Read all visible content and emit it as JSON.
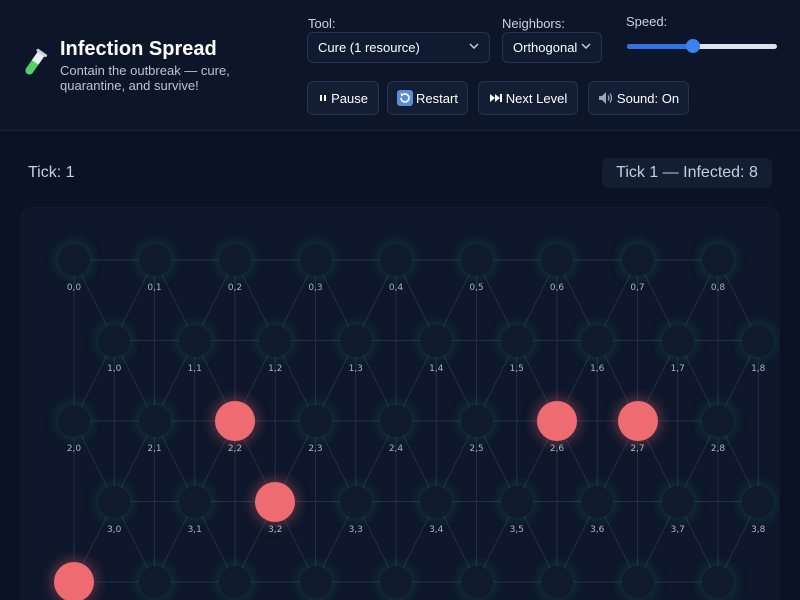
{
  "app": {
    "title": "Infection Spread",
    "subtitle": "Contain the outbreak — cure, quarantine, and survive!",
    "icon": "test-tube-icon"
  },
  "controls": {
    "tool": {
      "label": "Tool:",
      "value": "Cure (1 resource)"
    },
    "neighbors": {
      "label": "Neighbors:",
      "value": "Orthogonal"
    },
    "speed": {
      "label": "Speed:",
      "value": 0.44
    }
  },
  "buttons": {
    "pause": "Pause",
    "restart": "Restart",
    "next_level": "Next Level",
    "sound": "Sound: On"
  },
  "status": {
    "tick": "Tick: 1",
    "summary": "Tick 1 — Infected: 8"
  },
  "grid": {
    "rows": 5,
    "cols": 9,
    "infected": [
      "2,2",
      "2,6",
      "2,7",
      "3,2",
      "4,0"
    ]
  },
  "colors": {
    "background": "#0b1224",
    "node": "#0f1a2a",
    "infected": "#ef6b72",
    "edge": "#2a3a52",
    "accent": "#2f74e0"
  }
}
